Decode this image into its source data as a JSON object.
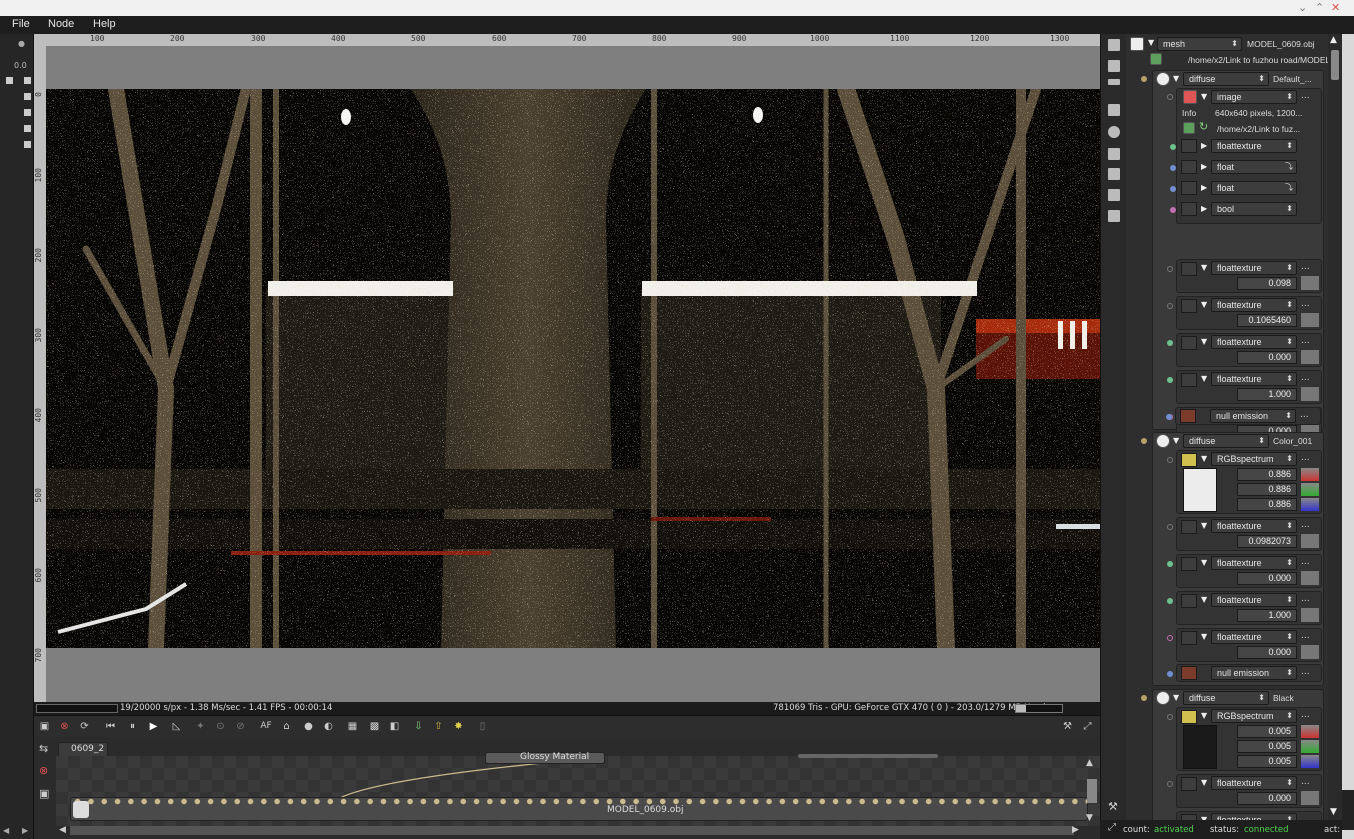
{
  "window": {
    "minimize": "⌄",
    "maximize": "⌃",
    "close": "✕"
  },
  "menu": [
    "File",
    "Node",
    "Help"
  ],
  "ruler_h": [
    "100",
    "200",
    "300",
    "400",
    "500",
    "600",
    "700",
    "800",
    "900",
    "1000",
    "1100",
    "1200",
    "1300"
  ],
  "ruler_v": [
    "0",
    "100",
    "200",
    "300",
    "400",
    "500",
    "600",
    "700"
  ],
  "left_strip": {
    "zoom_label": "0.0"
  },
  "status": {
    "progress": "19/20000 s/px - 1.38 Ms/sec - 1.41 FPS - 00:00:14",
    "gpu": "781069 Tris - GPU: GeForce GTX 470 ( 0 ) - 203.0/1279 MB Used",
    "af_label": "AF"
  },
  "node_editor": {
    "tab": "0609_2",
    "nodes": {
      "material": "Glossy Material",
      "mesh": "MODEL_0609.obj"
    }
  },
  "inspector": {
    "top": {
      "type": "mesh",
      "name": "MODEL_0609.obj",
      "path": "/home/x2/Link to fuzhou road/MODEL_..."
    },
    "groups": [
      {
        "type": "diffuse",
        "name": "Default_...",
        "image": {
          "type": "image",
          "info_label": "Info",
          "info_value": "640x640 pixels, 1200...",
          "path": "/home/x2/Link to fuz..."
        },
        "sub_rows": [
          "floattexture",
          "float",
          "float",
          "bool"
        ],
        "params": [
          {
            "type": "floattexture",
            "value": "0.098"
          },
          {
            "type": "floattexture",
            "value": "0.1065460"
          },
          {
            "type": "floattexture",
            "value": "0.000"
          },
          {
            "type": "floattexture",
            "value": "1.000"
          },
          {
            "type": "floattexture",
            "value": "0.000"
          }
        ],
        "emission": "null emission"
      },
      {
        "type": "diffuse",
        "name": "Color_001",
        "rgb": {
          "type": "RGBspectrum",
          "r": "0.886",
          "g": "0.886",
          "b": "0.886"
        },
        "params": [
          {
            "type": "floattexture",
            "value": "0.0982073"
          },
          {
            "type": "floattexture",
            "value": "0.000"
          },
          {
            "type": "floattexture",
            "value": "1.000"
          },
          {
            "type": "floattexture",
            "value": "0.000"
          }
        ],
        "emission": "null emission"
      },
      {
        "type": "diffuse",
        "name": "Black",
        "rgb": {
          "type": "RGBspectrum",
          "r": "0.005",
          "g": "0.005",
          "b": "0.005"
        },
        "params": [
          {
            "type": "floattexture",
            "value": "0.000"
          },
          {
            "type": "floattexture",
            "value": ""
          }
        ]
      }
    ],
    "dots": "..."
  },
  "bottom_status": {
    "count_label": "count:",
    "count_value": "activated",
    "status_label": "status:",
    "status_value": "connected",
    "act_label": "act:"
  },
  "colors": {
    "accent_green": "#4fd24f",
    "pin_tan": "#b8a06a",
    "pin_green": "#6fbf8f",
    "pin_blue": "#6f8fd0",
    "pin_pink": "#c06fb0"
  }
}
